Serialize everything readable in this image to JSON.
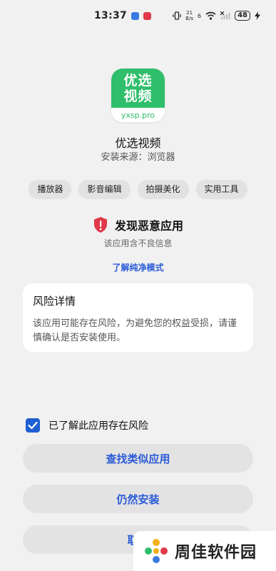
{
  "status_bar": {
    "time": "13:37",
    "net_speed_top": "21",
    "net_speed_bottom": "B/s",
    "signal_label": "6",
    "battery": "48",
    "notif_colors": [
      "#3a7be0",
      "#e0394a"
    ]
  },
  "app": {
    "icon_text": "优选视频",
    "icon_domain": "yxsp.pro",
    "name": "优选视频",
    "source": "安装来源：浏览器",
    "tags": [
      "播放器",
      "影音编辑",
      "拍摄美化",
      "实用工具"
    ]
  },
  "warning": {
    "title": "发现恶意应用",
    "subtitle": "该应用含不良信息",
    "link": "了解纯净模式",
    "icon": "shield-alert-icon",
    "icon_color": "#e0394a"
  },
  "risk_card": {
    "title": "风险详情",
    "text": "该应用可能存在风险，为避免您的权益受损，请谨慎确认是否安装使用。"
  },
  "confirm": {
    "checked": true,
    "label": "已了解此应用存在风险"
  },
  "buttons": {
    "find_similar": "查找类似应用",
    "still_install": "仍然安装",
    "cancel": "取消"
  },
  "watermark": {
    "text": "周佳软件园"
  },
  "colors": {
    "accent": "#2a5bd7",
    "app_green": "#2fbe6b",
    "background": "#f1f1f1"
  }
}
